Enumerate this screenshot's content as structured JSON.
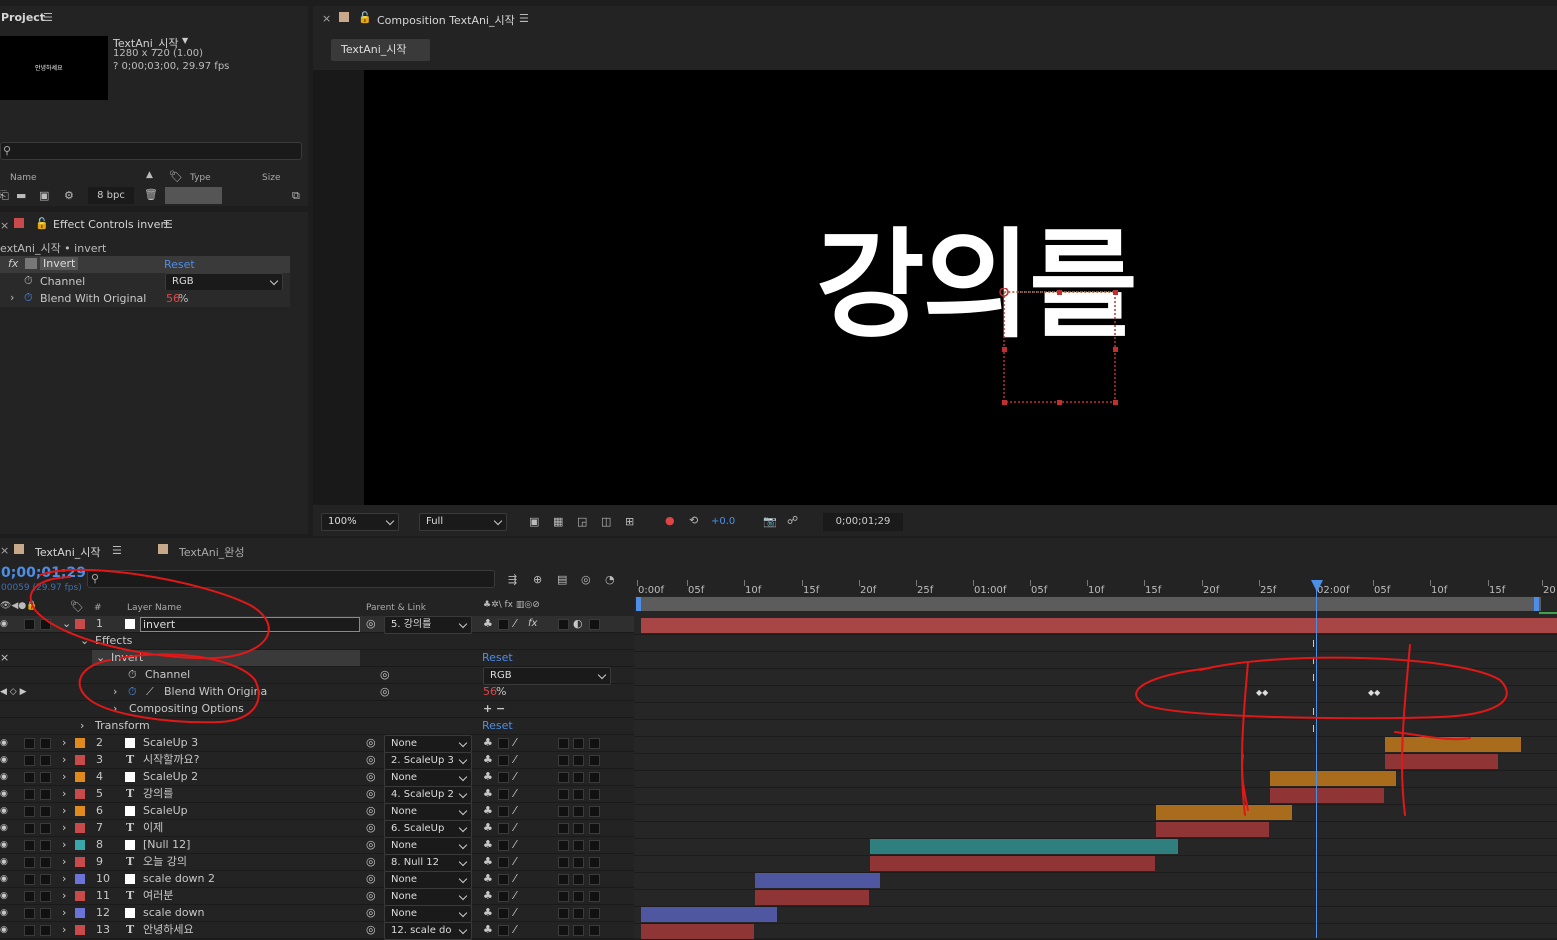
{
  "project": {
    "tab": "Project",
    "thumb_text": "안녕하세요",
    "comp_name": "TextAni_시작",
    "comp_size": "1280 x 720 (1.00)",
    "comp_duration": "? 0;00;03;00, 29.97 fps",
    "col_name": "Name",
    "col_type": "Type",
    "col_size": "Size",
    "bpc": "8 bpc"
  },
  "effect_controls": {
    "tab": "Effect Controls invert",
    "breadcrumb": "extAni_시작 • invert",
    "fx_icon": "fx",
    "effect_name": "Invert",
    "reset": "Reset",
    "channel_label": "Channel",
    "channel_value": "RGB",
    "blend_label": "Blend With Original",
    "blend_value": "56",
    "percent": "%"
  },
  "composition": {
    "tab": "Composition TextAni_시작",
    "subtab": "TextAni_시작",
    "canvas_text": "강의를",
    "zoom": "100%",
    "quality": "Full",
    "exposure": "+0.0",
    "timecode": "0;00;01;29"
  },
  "timeline": {
    "tab1": "TextAni_시작",
    "tab2": "TextAni_완성",
    "timecode": "0;00;01;29",
    "fps": "00059 (29.97 fps)",
    "col_num": "#",
    "col_layer": "Layer Name",
    "col_parent": "Parent & Link",
    "effects_label": "Effects",
    "invert_label": "Invert",
    "reset": "Reset",
    "channel_label": "Channel",
    "channel_value": "RGB",
    "blend_label": "Blend With Origina",
    "blend_value": "56",
    "percent": "%",
    "compositing_label": "Compositing Options",
    "compositing_ctrl": "+ −",
    "transform_label": "Transform",
    "ticks": [
      "0:00f",
      "05f",
      "10f",
      "15f",
      "20f",
      "25f",
      "01:00f",
      "05f",
      "10f",
      "15f",
      "20f",
      "25f",
      "02:00f",
      "05f",
      "10f",
      "15f",
      "20"
    ],
    "layers": [
      {
        "num": "1",
        "name": "invert",
        "parent": "5. 강의를",
        "color": "#c94a4a",
        "type": "solid"
      },
      {
        "num": "2",
        "name": "ScaleUp 3",
        "parent": "None",
        "color": "#e08a1e",
        "type": "solid"
      },
      {
        "num": "3",
        "name": "시작할까요?",
        "parent": "2. ScaleUp 3",
        "color": "#c94a4a",
        "type": "text"
      },
      {
        "num": "4",
        "name": "ScaleUp 2",
        "parent": "None",
        "color": "#e08a1e",
        "type": "solid"
      },
      {
        "num": "5",
        "name": "강의를",
        "parent": "4. ScaleUp 2",
        "color": "#c94a4a",
        "type": "text"
      },
      {
        "num": "6",
        "name": "ScaleUp",
        "parent": "None",
        "color": "#e08a1e",
        "type": "solid"
      },
      {
        "num": "7",
        "name": "이제",
        "parent": "6. ScaleUp",
        "color": "#c94a4a",
        "type": "text"
      },
      {
        "num": "8",
        "name": "[Null 12]",
        "parent": "None",
        "color": "#3aa8a8",
        "type": "solid"
      },
      {
        "num": "9",
        "name": "오늘 강의",
        "parent": "8. Null 12",
        "color": "#c94a4a",
        "type": "text"
      },
      {
        "num": "10",
        "name": "scale down 2",
        "parent": "None",
        "color": "#6b74d6",
        "type": "solid"
      },
      {
        "num": "11",
        "name": "여러분",
        "parent": "None",
        "color": "#c94a4a",
        "type": "text"
      },
      {
        "num": "12",
        "name": "scale down",
        "parent": "None",
        "color": "#6b74d6",
        "type": "solid"
      },
      {
        "num": "13",
        "name": "안녕하세요",
        "parent": "12. scale do",
        "color": "#c94a4a",
        "type": "text"
      }
    ]
  },
  "colors": {
    "accent_blue": "#4d8ee6",
    "value_red": "#d84a4a",
    "annotation_red": "#e01818"
  }
}
